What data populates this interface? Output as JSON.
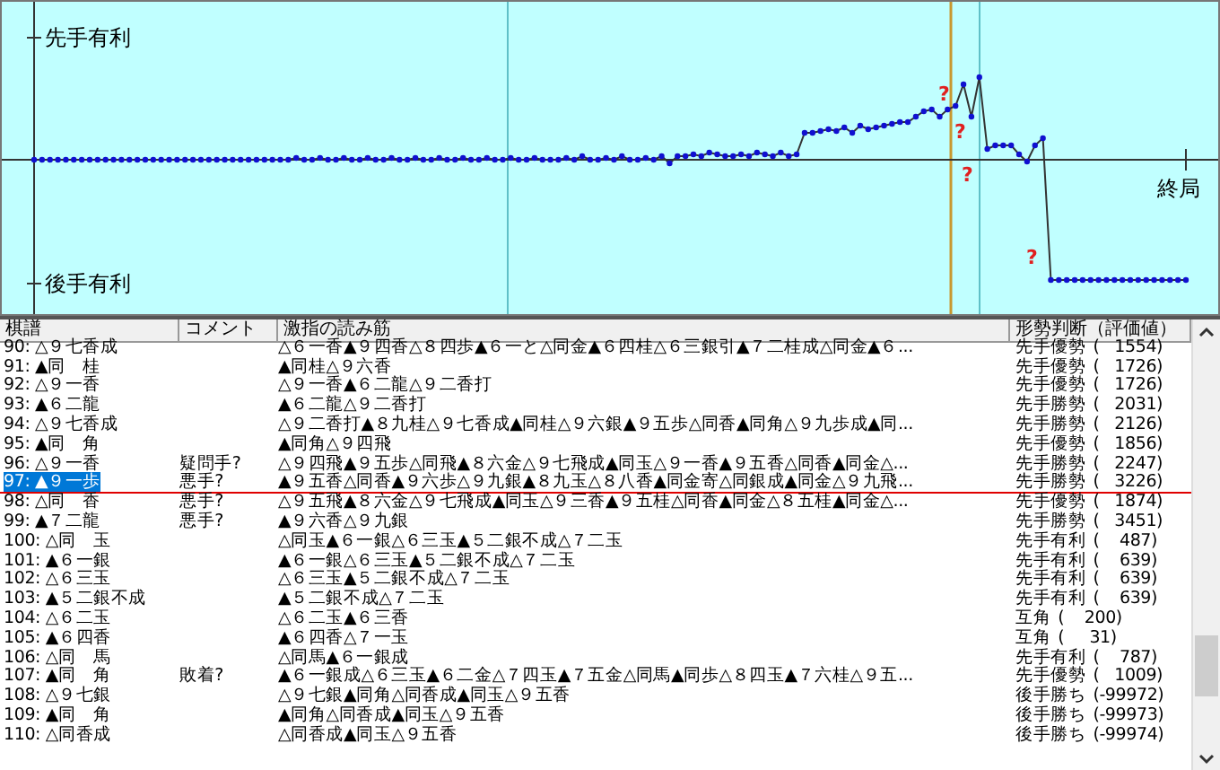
{
  "graph": {
    "top_label": "先手有利",
    "bottom_label": "後手有利",
    "end_label": "終局",
    "marks": [
      "?",
      "?",
      "?",
      "?"
    ]
  },
  "table": {
    "columns": [
      "棋譜",
      "コメント",
      "激指の読み筋",
      "形勢判断（評価値）"
    ],
    "rows": [
      {
        "move": "90: △９七香成",
        "comment": "",
        "line": "△６一香▲９四香△８四歩▲６一と△同金▲６四桂△６三銀引▲７二桂成△同金▲６...",
        "judgment": "先手優勢",
        "score": "(   1554)",
        "selected": false
      },
      {
        "move": "91: ▲同　桂",
        "comment": "",
        "line": "▲同桂△９六香",
        "judgment": "先手優勢",
        "score": "(   1726)",
        "selected": false
      },
      {
        "move": "92: △９一香",
        "comment": "",
        "line": "△９一香▲６二龍△９二香打",
        "judgment": "先手優勢",
        "score": "(   1726)",
        "selected": false
      },
      {
        "move": "93: ▲６二龍",
        "comment": "",
        "line": "▲６二龍△９二香打",
        "judgment": "先手勝勢",
        "score": "(   2031)",
        "selected": false
      },
      {
        "move": "94: △９七香成",
        "comment": "",
        "line": "△９二香打▲８九桂△９七香成▲同桂△９六銀▲９五歩△同香▲同角△９九歩成▲同...",
        "judgment": "先手勝勢",
        "score": "(   2126)",
        "selected": false
      },
      {
        "move": "95: ▲同　角",
        "comment": "",
        "line": "▲同角△９四飛",
        "judgment": "先手優勢",
        "score": "(   1856)",
        "selected": false
      },
      {
        "move": "96: △９一香",
        "comment": "疑問手?",
        "line": "△９四飛▲９五歩△同飛▲８六金△９七飛成▲同玉△９一香▲９五香△同香▲同金△...",
        "judgment": "先手勝勢",
        "score": "(   2247)",
        "selected": false
      },
      {
        "move": "97: ▲９一歩",
        "comment": "悪手?",
        "line": "▲９五香△同香▲９六歩△９九銀▲８九玉△８八香▲同金寄△同銀成▲同金△９九飛...",
        "judgment": "先手勝勢",
        "score": "(   3226)",
        "selected": true
      },
      {
        "move": "98: △同　香",
        "comment": "悪手?",
        "line": "△９五飛▲８六金△９七飛成▲同玉△９三香▲９五桂△同香▲同金△８五桂▲同金△...",
        "judgment": "先手優勢",
        "score": "(   1874)",
        "selected": false
      },
      {
        "move": "99: ▲７二龍",
        "comment": "悪手?",
        "line": "▲９六香△９九銀",
        "judgment": "先手勝勢",
        "score": "(   3451)",
        "selected": false
      },
      {
        "move": "100: △同　玉",
        "comment": "",
        "line": "△同玉▲６一銀△６三玉▲５二銀不成△７二玉",
        "judgment": "先手有利",
        "score": "(    487)",
        "selected": false
      },
      {
        "move": "101: ▲６一銀",
        "comment": "",
        "line": "▲６一銀△６三玉▲５二銀不成△７二玉",
        "judgment": "先手有利",
        "score": "(    639)",
        "selected": false
      },
      {
        "move": "102: △６三玉",
        "comment": "",
        "line": "△６三玉▲５二銀不成△７二玉",
        "judgment": "先手有利",
        "score": "(    639)",
        "selected": false
      },
      {
        "move": "103: ▲５二銀不成",
        "comment": "",
        "line": "▲５二銀不成△７二玉",
        "judgment": "先手有利",
        "score": "(    639)",
        "selected": false
      },
      {
        "move": "104: △６二玉",
        "comment": "",
        "line": "△６二玉▲６三香",
        "judgment": "互角",
        "score": "(    200)",
        "selected": false
      },
      {
        "move": "105: ▲６四香",
        "comment": "",
        "line": "▲６四香△７一玉",
        "judgment": "互角",
        "score": "(     31)",
        "selected": false
      },
      {
        "move": "106: △同　馬",
        "comment": "",
        "line": "△同馬▲６一銀成",
        "judgment": "先手有利",
        "score": "(    787)",
        "selected": false
      },
      {
        "move": "107: ▲同　角",
        "comment": "敗着?",
        "line": "▲６一銀成△６三玉▲６二金△７四玉▲７五金△同馬▲同歩△８四玉▲７六桂△９五...",
        "judgment": "先手優勢",
        "score": "(   1009)",
        "selected": false
      },
      {
        "move": "108: △９七銀",
        "comment": "",
        "line": "△９七銀▲同角△同香成▲同玉△９五香",
        "judgment": "後手勝ち",
        "score": "(-99972)",
        "selected": false
      },
      {
        "move": "109: ▲同　角",
        "comment": "",
        "line": "▲同角△同香成▲同玉△９五香",
        "judgment": "後手勝ち",
        "score": "(-99973)",
        "selected": false
      },
      {
        "move": "110: △同香成",
        "comment": "",
        "line": "△同香成▲同玉△９五香",
        "judgment": "後手勝ち",
        "score": "(-99974)",
        "selected": false
      }
    ]
  }
}
